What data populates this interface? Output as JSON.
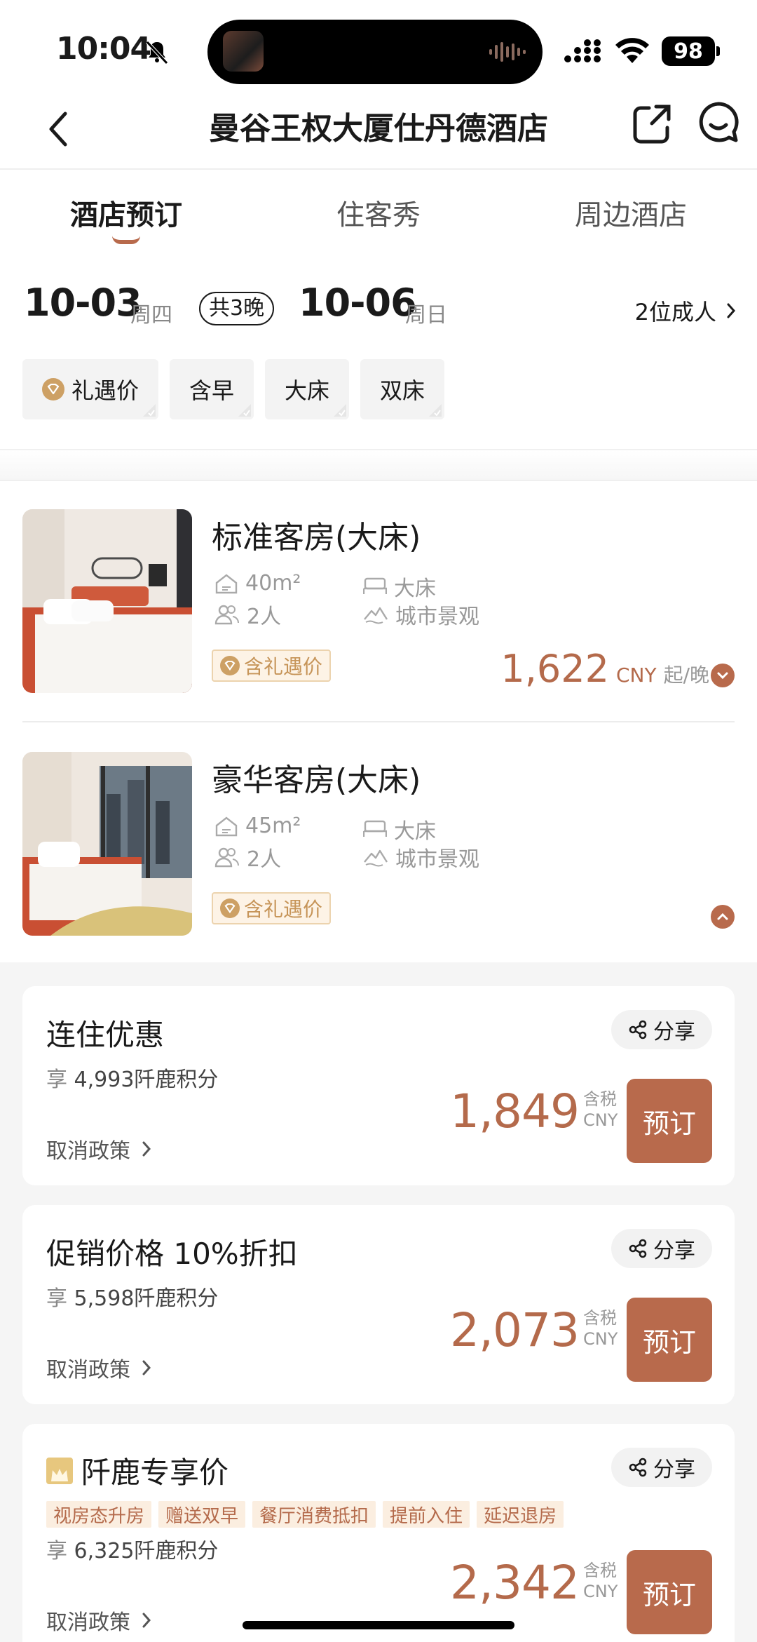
{
  "status": {
    "time": "10:04",
    "battery": "98"
  },
  "nav": {
    "title": "曼谷王权大厦仕丹德酒店"
  },
  "tabs": [
    {
      "label": "酒店预订",
      "active": true
    },
    {
      "label": "住客秀",
      "active": false
    },
    {
      "label": "周边酒店",
      "active": false
    }
  ],
  "stay": {
    "checkin_date": "10-03",
    "checkin_weekday": "周四",
    "nights": "共3晚",
    "checkout_date": "10-06",
    "checkout_weekday": "周日",
    "guests": "2位成人"
  },
  "filters": [
    "礼遇价",
    "含早",
    "大床",
    "双床"
  ],
  "rooms": [
    {
      "name": "标准客房(大床)",
      "size": "40m²",
      "bed": "大床",
      "occupancy": "2人",
      "view": "城市景观",
      "tag": "含礼遇价",
      "price": "1,622",
      "currency": "CNY",
      "per": "起/晚"
    },
    {
      "name": "豪华客房(大床)",
      "size": "45m²",
      "bed": "大床",
      "occupancy": "2人",
      "view": "城市景观",
      "tag": "含礼遇价"
    }
  ],
  "rates": [
    {
      "name": "连住优惠",
      "points_prefix": "享",
      "points": "4,993阡鹿积分",
      "cancel": "取消政策",
      "share": "分享",
      "price": "1,849",
      "tax_1": "含税",
      "tax_2": "CNY",
      "book": "预订"
    },
    {
      "name": "促销价格 10%折扣",
      "points_prefix": "享",
      "points": "5,598阡鹿积分",
      "cancel": "取消政策",
      "share": "分享",
      "price": "2,073",
      "tax_1": "含税",
      "tax_2": "CNY",
      "book": "预订"
    },
    {
      "name": "阡鹿专享价",
      "points_prefix": "享",
      "points": "6,325阡鹿积分",
      "cancel": "取消政策",
      "share": "分享",
      "price": "2,342",
      "tax_1": "含税",
      "tax_2": "CNY",
      "book": "预订",
      "perks": [
        "视房态升房",
        "赠送双早",
        "餐厅消费抵扣",
        "提前入住",
        "延迟退房"
      ]
    }
  ],
  "colors": {
    "accent": "#b86a4c",
    "gift": "#cda064"
  }
}
